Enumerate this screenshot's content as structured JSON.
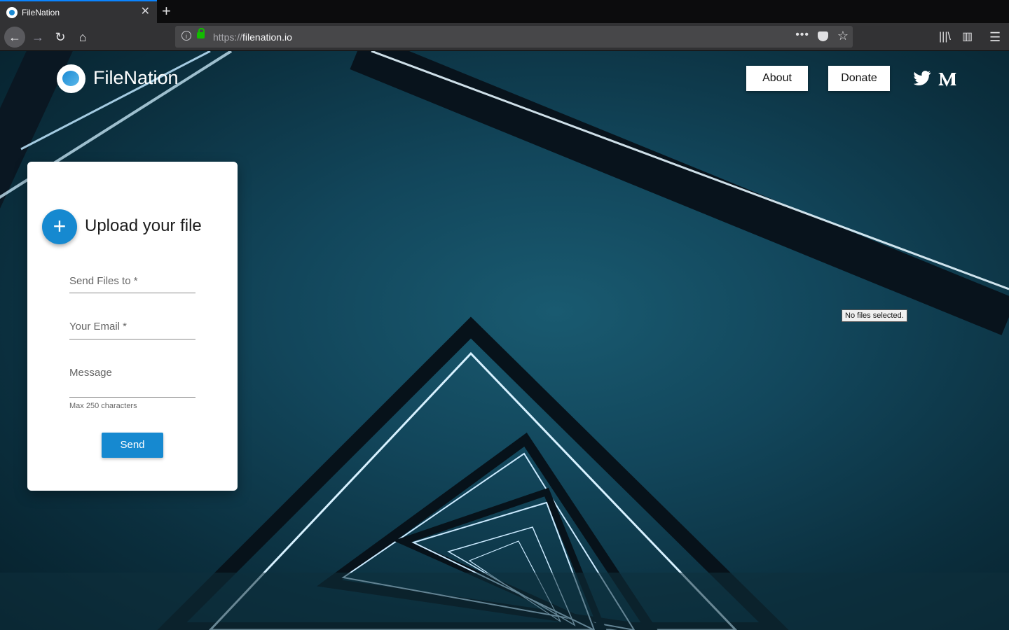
{
  "browser": {
    "tab_title": "FileNation",
    "tab_close": "✕",
    "new_tab": "+",
    "url_protocol": "https://",
    "url_host": "filenation.io",
    "back_icon": "←",
    "forward_icon": "→",
    "reload_icon": "↻",
    "home_icon": "⌂",
    "page_actions": "•••",
    "bookmark_icon": "☆",
    "library_icon": "|||\\",
    "sidebar_icon": "▥",
    "menu_icon": "☰"
  },
  "header": {
    "brand": "FileNation",
    "about_label": "About",
    "donate_label": "Donate",
    "social": [
      "twitter",
      "medium"
    ]
  },
  "upload_card": {
    "plus": "+",
    "title": "Upload your file",
    "send_to_label": "Send Files to *",
    "email_label": "Your Email *",
    "message_label": "Message",
    "message_hint": "Max 250 characters",
    "send_label": "Send"
  },
  "tooltip": {
    "text": "No files selected."
  },
  "colors": {
    "accent": "#1689d0",
    "tab_highlight": "#0a84ff",
    "lock": "#12bc00"
  }
}
